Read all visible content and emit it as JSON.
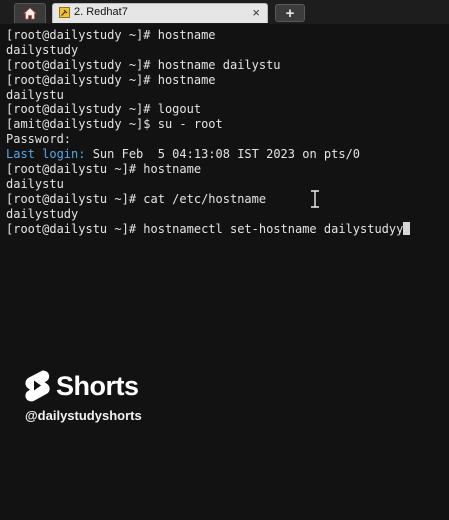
{
  "tabs": {
    "home_icon": "home-icon",
    "session": {
      "label": "2. Redhat7",
      "icon": "session-key-icon",
      "close_label": "×"
    },
    "new_tab_label": "+"
  },
  "terminal": {
    "lines": [
      [
        {
          "t": "[root@dailystudy ~]# hostname"
        }
      ],
      [
        {
          "t": "dailystudy"
        }
      ],
      [
        {
          "t": "[root@dailystudy ~]# hostname dailystu"
        }
      ],
      [
        {
          "t": "[root@dailystudy ~]# hostname"
        }
      ],
      [
        {
          "t": "dailystu"
        }
      ],
      [
        {
          "t": "[root@dailystudy ~]# logout"
        }
      ],
      [
        {
          "t": "[amit@dailystudy ~]$ su - root"
        }
      ],
      [
        {
          "t": "Password:"
        }
      ],
      [
        {
          "t": "Last login:",
          "c": "blue"
        },
        {
          "t": " Sun Feb  5 04:13:08 IST 2023 on pts/0"
        }
      ],
      [
        {
          "t": "[root@dailystu ~]# hostname"
        }
      ],
      [
        {
          "t": "dailystu"
        }
      ],
      [
        {
          "t": "[root@dailystu ~]# cat /etc/hostname"
        }
      ],
      [
        {
          "t": "dailystudy"
        }
      ],
      [
        {
          "t": "[root@dailystu ~]# hostnamectl set-hostname dailystudyy"
        }
      ]
    ],
    "cursor_line": 13
  },
  "overlay": {
    "brand": "Shorts",
    "handle": "@dailystudyshorts"
  }
}
